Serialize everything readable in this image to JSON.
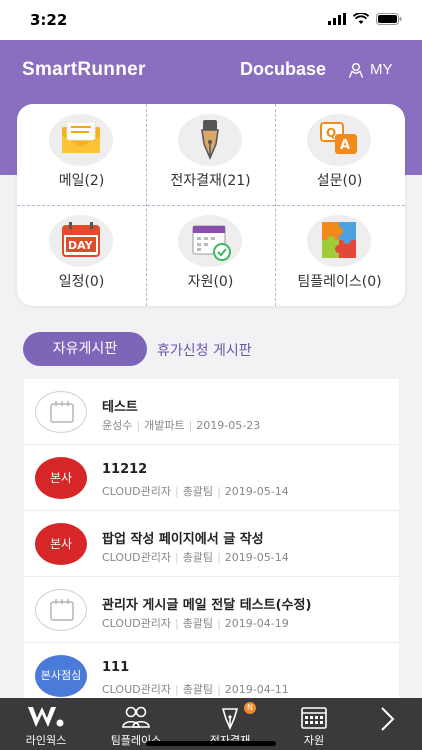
{
  "status": {
    "time": "3:22"
  },
  "header": {
    "brand": "SmartRunner",
    "docu": "Docubase",
    "my": "MY"
  },
  "menu": [
    {
      "label": "메일(2)",
      "icon": "mail-icon"
    },
    {
      "label": "전자결재(21)",
      "icon": "fountain-pen-icon"
    },
    {
      "label": "설문(0)",
      "icon": "qa-survey-icon"
    },
    {
      "label": "일정(0)",
      "icon": "day-calendar-icon"
    },
    {
      "label": "자원(0)",
      "icon": "resource-calendar-check-icon"
    },
    {
      "label": "팀플레이스(0)",
      "icon": "puzzle-icon"
    }
  ],
  "board_tabs": {
    "active": "자유게시판",
    "other": "휴가신청 게시판"
  },
  "posts": [
    {
      "avatar": "",
      "avatar_type": "gray",
      "title": "테스트",
      "author": "윤성수",
      "dept": "개발파트",
      "date": "2019-05-23"
    },
    {
      "avatar": "본사",
      "avatar_type": "red",
      "title": "11212",
      "author": "CLOUD관리자",
      "dept": "총괄팀",
      "date": "2019-05-14"
    },
    {
      "avatar": "본사",
      "avatar_type": "red",
      "title": "팝업 작성 페이지에서 글 작성",
      "author": "CLOUD관리자",
      "dept": "총괄팀",
      "date": "2019-05-14"
    },
    {
      "avatar": "",
      "avatar_type": "gray",
      "title": "관리자 게시글 메일 전달 테스트(수정)",
      "author": "CLOUD관리자",
      "dept": "총괄팀",
      "date": "2019-04-19"
    },
    {
      "avatar": "본사점심",
      "avatar_type": "blue",
      "title": "111",
      "author": "CLOUD관리자",
      "dept": "총괄팀",
      "date": "2019-04-11"
    }
  ],
  "bottom_nav": [
    {
      "label": "라인웍스",
      "icon": "w-logo-icon"
    },
    {
      "label": "팀플레이스",
      "icon": "people-icon"
    },
    {
      "label": "전자결재",
      "icon": "pen-icon",
      "badge": "N"
    },
    {
      "label": "자원",
      "icon": "calendar-grid-icon"
    },
    {
      "label": "",
      "icon": "chevron-right-icon"
    }
  ],
  "colors": {
    "header": "#8a6fc0",
    "tab_active": "#7d66b8",
    "badge_red": "#d62628",
    "badge_blue": "#4a7bd8",
    "bottom_bar": "#3a3a3c"
  }
}
